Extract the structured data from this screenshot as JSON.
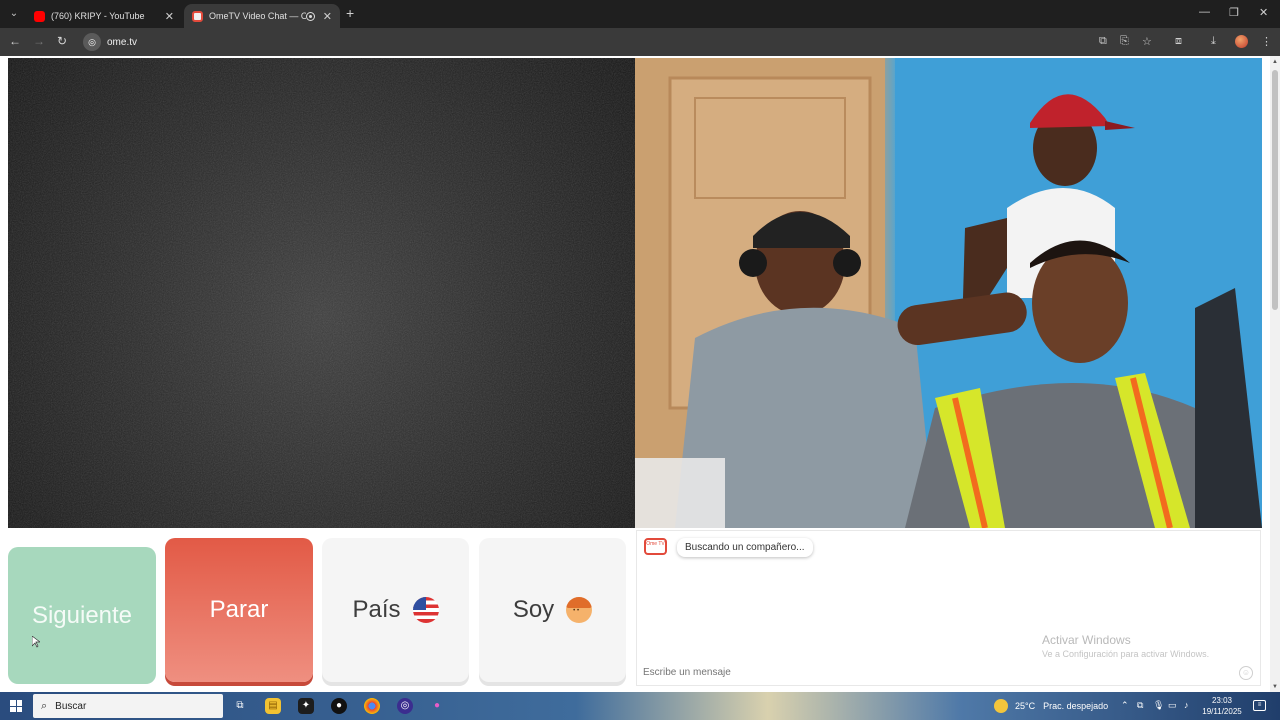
{
  "browser": {
    "tabs": [
      {
        "title": "(760) KRIPY - YouTube",
        "favicon": "youtube-icon",
        "active": false
      },
      {
        "title": "OmeTV Video Chat — Ome",
        "favicon": "ometv-icon",
        "active": true,
        "recording": true
      }
    ],
    "url": "ome.tv"
  },
  "page": {
    "buttons": {
      "next": "Siguiente",
      "stop": "Parar",
      "country": "País",
      "gender": "Soy"
    },
    "chat": {
      "logo_text": "Ome TV",
      "status_message": "Buscando un compañero...",
      "message_placeholder": "Escribe un mensaje"
    },
    "watermark": {
      "title": "Activar Windows",
      "subtitle": "Ve a Configuración para activar Windows."
    }
  },
  "taskbar": {
    "search_placeholder": "Buscar",
    "weather_temp": "25°C",
    "weather_desc": "Prac. despejado",
    "time": "23:03",
    "date": "19/11/2025"
  },
  "colors": {
    "next_button": "#a7d8bd",
    "stop_button": "#e8705e",
    "chat_accent": "#e24a3b"
  }
}
